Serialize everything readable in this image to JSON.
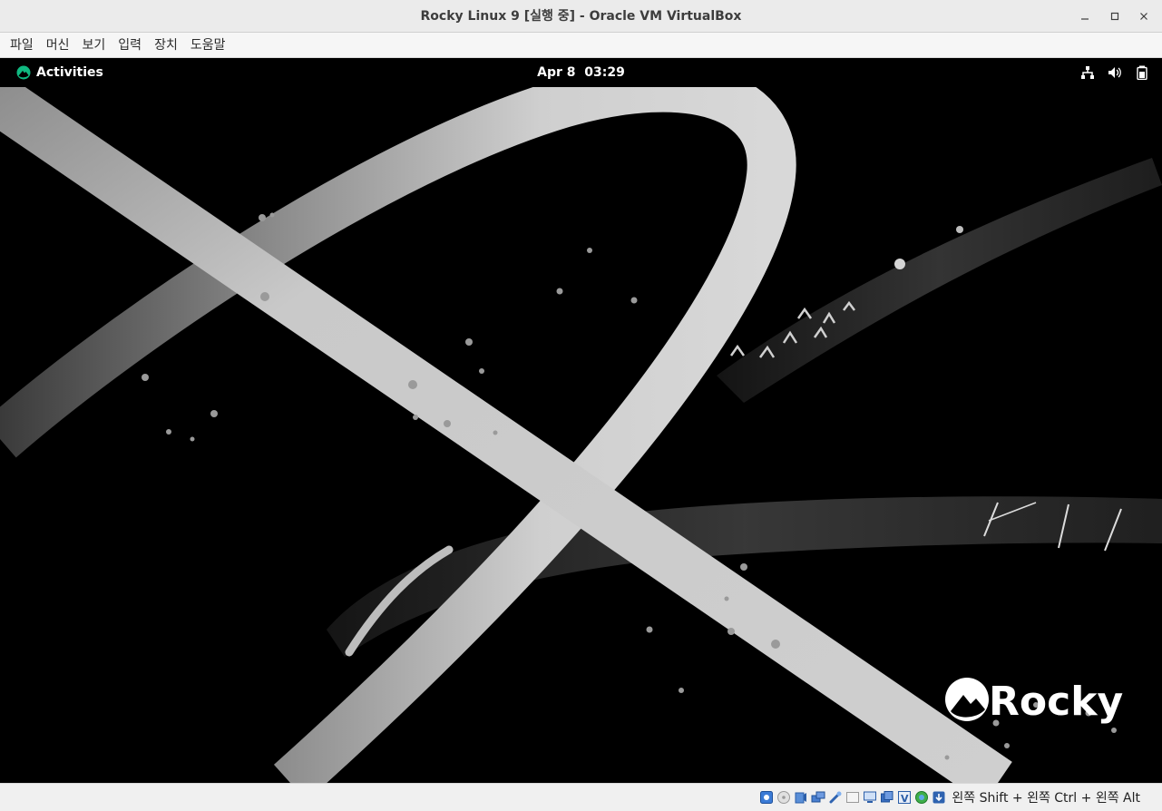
{
  "window": {
    "title": "Rocky Linux 9 [실행 중] - Oracle VM VirtualBox",
    "minimize_glyph": "—",
    "maximize_glyph": "□",
    "close_glyph": "✕"
  },
  "menubar": {
    "items": [
      {
        "label": "파일"
      },
      {
        "label": "머신"
      },
      {
        "label": "보기"
      },
      {
        "label": "입력"
      },
      {
        "label": "장치"
      },
      {
        "label": "도움말"
      }
    ]
  },
  "guest": {
    "activities_label": "Activities",
    "clock_date": "Apr 8",
    "clock_time": "03:29",
    "tray_icons": [
      "network-wired-icon",
      "volume-icon",
      "battery-icon"
    ],
    "wallpaper_logo_text": "Rocky",
    "accent_color": "#10b981"
  },
  "statusbar": {
    "icons": [
      "hard-disk-icon",
      "optical-drive-icon",
      "audio-icon",
      "network-icon",
      "usb-icon",
      "shared-folders-icon",
      "display-icon",
      "video-capture-icon",
      "recording-icon",
      "cpu-icon",
      "mouse-integration-icon",
      "keyboard-capture-icon"
    ],
    "host_key": "왼쪽 Shift + 왼쪽 Ctrl + 왼쪽 Alt"
  }
}
